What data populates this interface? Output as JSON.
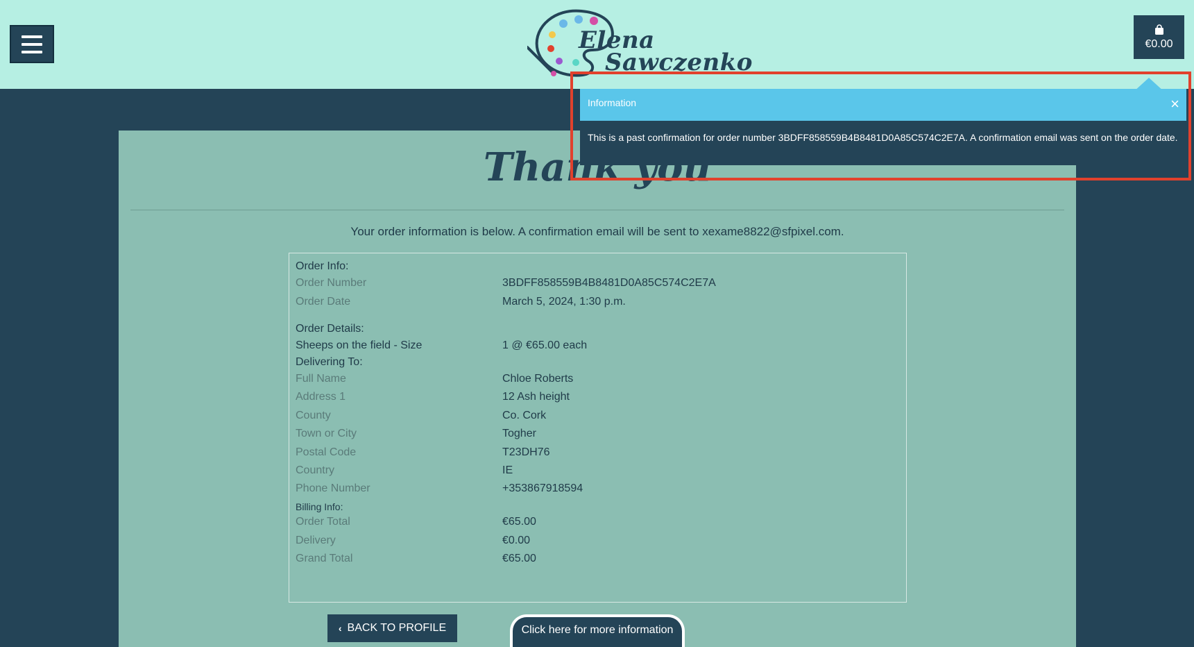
{
  "header": {
    "brand_first": "Elena",
    "brand_last": "Sawczenko",
    "cart_amount": "€0.00"
  },
  "toast": {
    "title": "Information",
    "message": "This is a past confirmation for order number 3BDFF858559B4B8481D0A85C574C2E7A. A confirmation email was sent on the order date.",
    "close_icon": "×"
  },
  "page": {
    "title": "Thank you",
    "intro": "Your order information is below. A confirmation email will be sent to xexame8822@sfpixel.com."
  },
  "order": {
    "info_heading": "Order Info:",
    "number_label": "Order Number",
    "number_value": "3BDFF858559B4B8481D0A85C574C2E7A",
    "date_label": "Order Date",
    "date_value": "March 5, 2024, 1:30 p.m.",
    "details_heading": "Order Details:",
    "item_name": "Sheeps on the field - Size",
    "item_qty": "1 @ €65.00 each",
    "delivering_heading": "Delivering To:",
    "delivery": [
      {
        "label": "Full Name",
        "value": "Chloe Roberts"
      },
      {
        "label": "Address 1",
        "value": "12 Ash height"
      },
      {
        "label": "County",
        "value": "Co. Cork"
      },
      {
        "label": "Town or City",
        "value": "Togher"
      },
      {
        "label": "Postal Code",
        "value": "T23DH76"
      },
      {
        "label": "Country",
        "value": "IE"
      },
      {
        "label": "Phone Number",
        "value": "+353867918594"
      }
    ],
    "billing_heading": "Billing Info:",
    "billing": [
      {
        "label": "Order Total",
        "value": "€65.00"
      },
      {
        "label": "Delivery",
        "value": "€0.00"
      },
      {
        "label": "Grand Total",
        "value": "€65.00"
      }
    ]
  },
  "buttons": {
    "back_label": "BACK TO PROFILE",
    "more_label": "Click here for more information"
  },
  "colors": {
    "header_bg": "#b6efe3",
    "page_bg": "#244457",
    "panel_bg": "#8bbeb2",
    "toast_head": "#5ac6ea",
    "highlight": "#e1412d"
  }
}
